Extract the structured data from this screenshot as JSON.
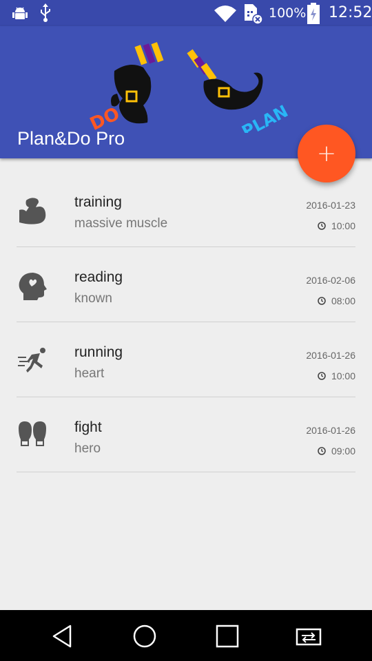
{
  "status_bar": {
    "battery_percent": "100%",
    "time": "12:52",
    "icons": [
      "android-debug-icon",
      "usb-icon",
      "wifi-icon",
      "no-sim-icon",
      "battery-charging-icon"
    ]
  },
  "app_bar": {
    "title": "Plan&Do Pro",
    "logo_text_do": "DO",
    "logo_text_plan": "PLAN",
    "background_color": "#3f51b5"
  },
  "fab": {
    "label": "+",
    "color": "#ff5722"
  },
  "tasks": [
    {
      "title": "training",
      "subtitle": "massive muscle",
      "date": "2016-01-23",
      "time": "10:00",
      "icon": "muscle-arm-icon"
    },
    {
      "title": "reading",
      "subtitle": "known",
      "date": "2016-02-06",
      "time": "08:00",
      "icon": "head-heart-icon"
    },
    {
      "title": "running",
      "subtitle": "heart",
      "date": "2016-01-26",
      "time": "10:00",
      "icon": "runner-icon"
    },
    {
      "title": "fight",
      "subtitle": "hero",
      "date": "2016-01-26",
      "time": "09:00",
      "icon": "boxing-gloves-icon"
    }
  ],
  "nav_bar": {
    "buttons": [
      "back-icon",
      "home-icon",
      "recents-icon",
      "rotate-icon"
    ]
  }
}
